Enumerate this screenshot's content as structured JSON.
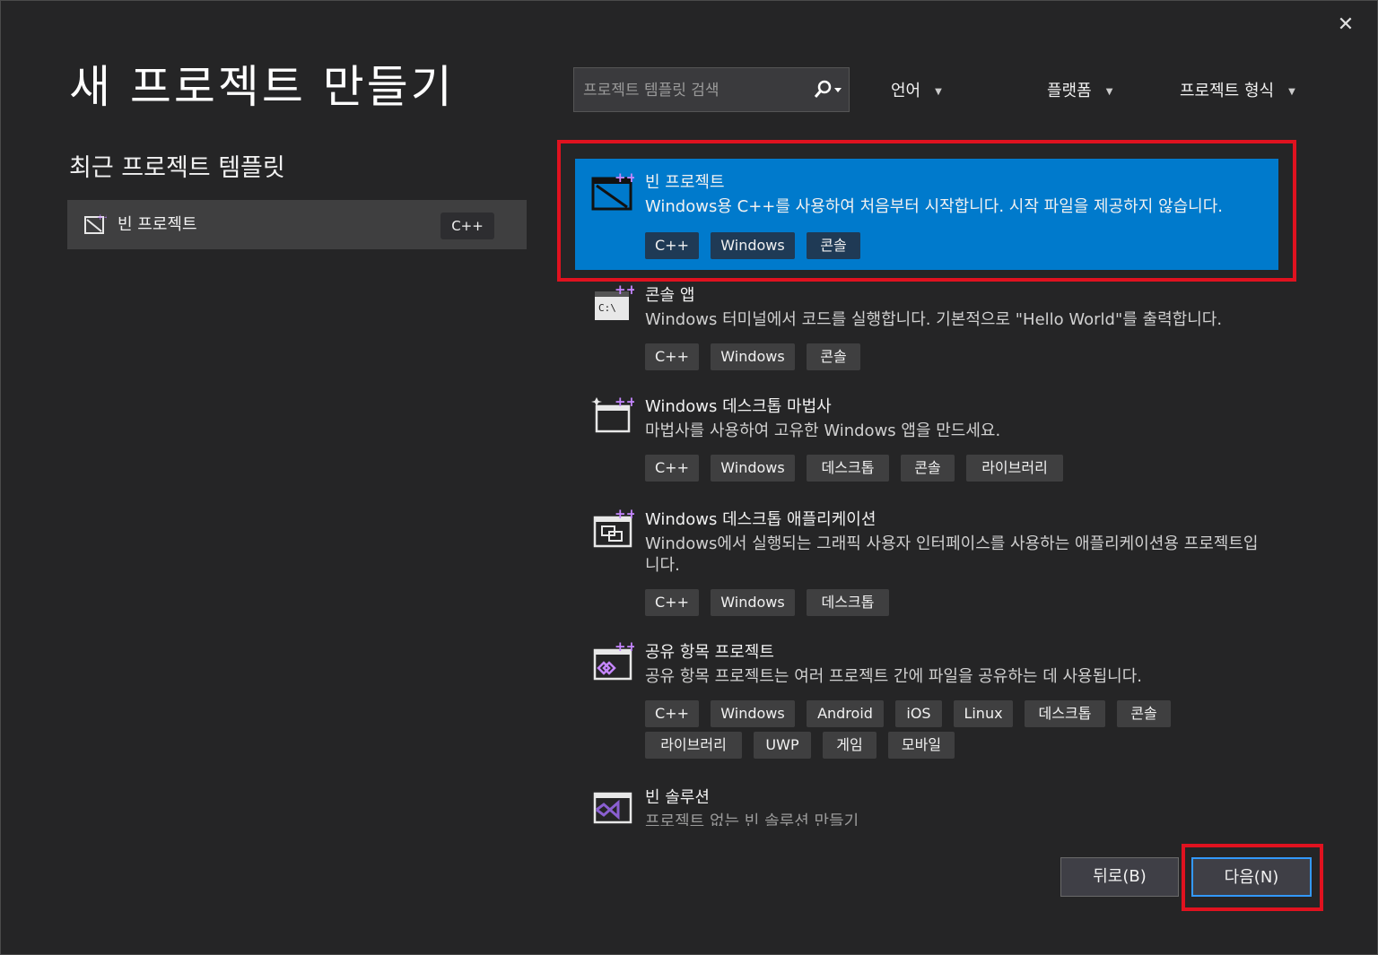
{
  "window": {
    "title": "새 프로젝트 만들기",
    "close_glyph": "✕"
  },
  "recent": {
    "heading": "최근 프로젝트 템플릿",
    "items": [
      {
        "label": "빈 프로젝트",
        "language": "C++"
      }
    ]
  },
  "search": {
    "placeholder": "프로젝트 템플릿 검색",
    "value": ""
  },
  "filters": {
    "language": "언어",
    "platform": "플랫폼",
    "project_type": "프로젝트 형식"
  },
  "templates": [
    {
      "name": "빈 프로젝트",
      "description": "Windows용 C++를 사용하여 처음부터 시작합니다. 시작 파일을 제공하지 않습니다.",
      "tags": [
        "C++",
        "Windows",
        "콘솔"
      ],
      "selected": true,
      "icon": "empty-project-icon"
    },
    {
      "name": "콘솔 앱",
      "description": "Windows 터미널에서 코드를 실행합니다. 기본적으로 \"Hello World\"를 출력합니다.",
      "tags": [
        "C++",
        "Windows",
        "콘솔"
      ],
      "selected": false,
      "icon": "console-app-icon"
    },
    {
      "name": "Windows 데스크톱 마법사",
      "description": "마법사를 사용하여 고유한 Windows 앱을 만드세요.",
      "tags": [
        "C++",
        "Windows",
        "데스크톱",
        "콘솔",
        "라이브러리"
      ],
      "selected": false,
      "icon": "wizard-icon"
    },
    {
      "name": "Windows 데스크톱 애플리케이션",
      "description": "Windows에서 실행되는 그래픽 사용자 인터페이스를 사용하는 애플리케이션용 프로젝트입니다.",
      "tags": [
        "C++",
        "Windows",
        "데스크톱"
      ],
      "selected": false,
      "icon": "desktop-app-icon"
    },
    {
      "name": "공유 항목 프로젝트",
      "description": "공유 항목 프로젝트는 여러 프로젝트 간에 파일을 공유하는 데 사용됩니다.",
      "tags": [
        "C++",
        "Windows",
        "Android",
        "iOS",
        "Linux",
        "데스크톱",
        "콘솔",
        "라이브러리",
        "UWP",
        "게임",
        "모바일"
      ],
      "selected": false,
      "icon": "shared-items-icon"
    },
    {
      "name": "빈 솔루션",
      "description": "프로젝트 없는 빈 솔루션 만들기",
      "tags": [],
      "selected": false,
      "icon": "blank-solution-icon"
    }
  ],
  "buttons": {
    "back": "뒤로(B)",
    "next": "다음(N)"
  },
  "colors": {
    "background": "#252526",
    "selected": "#007acc",
    "highlight_box": "#e0121f",
    "accent_plus": "#c586ff"
  }
}
